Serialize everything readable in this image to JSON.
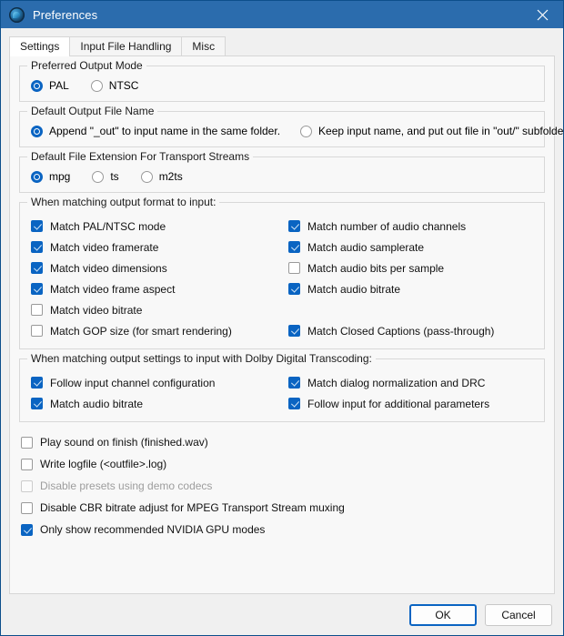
{
  "window": {
    "title": "Preferences",
    "app_icon": "app-globe-icon",
    "close_icon": "close-icon",
    "titlebar_color": "#2b6cad",
    "accent_color": "#0a64c2"
  },
  "tabs": [
    {
      "label": "Settings",
      "selected": true
    },
    {
      "label": "Input File Handling",
      "selected": false
    },
    {
      "label": "Misc",
      "selected": false
    }
  ],
  "groups": {
    "output_mode": {
      "legend": "Preferred Output Mode",
      "options": [
        {
          "label": "PAL",
          "checked": true
        },
        {
          "label": "NTSC",
          "checked": false
        }
      ]
    },
    "output_file_name": {
      "legend": "Default Output File Name",
      "options": [
        {
          "label": "Append \"_out\" to input  name in the same folder.",
          "checked": true
        },
        {
          "label": "Keep input name, and put out file in \"out/\" subfolder.",
          "checked": false
        }
      ]
    },
    "file_extension": {
      "legend": "Default File Extension For Transport Streams",
      "options": [
        {
          "label": "mpg",
          "checked": true
        },
        {
          "label": "ts",
          "checked": false
        },
        {
          "label": "m2ts",
          "checked": false
        }
      ]
    },
    "match_format": {
      "legend": "When matching output format to input:",
      "left_column": [
        {
          "label": "Match PAL/NTSC mode",
          "checked": true
        },
        {
          "label": "Match video framerate",
          "checked": true
        },
        {
          "label": "Match video dimensions",
          "checked": true
        },
        {
          "label": "Match video frame aspect",
          "checked": true
        },
        {
          "label": "Match video bitrate",
          "checked": false
        },
        {
          "label": "Match GOP size (for smart rendering)",
          "checked": false
        }
      ],
      "right_column": [
        {
          "label": "Match number of audio channels",
          "checked": true
        },
        {
          "label": "Match audio samplerate",
          "checked": true
        },
        {
          "label": "Match audio bits per sample",
          "checked": false
        },
        {
          "label": "Match audio bitrate",
          "checked": true
        },
        {
          "label": "",
          "spacer": true
        },
        {
          "label": "Match Closed Captions (pass-through)",
          "checked": true
        }
      ]
    },
    "dolby": {
      "legend": "When matching output settings to input with Dolby Digital Transcoding:",
      "left_column": [
        {
          "label": "Follow input channel configuration",
          "checked": true
        },
        {
          "label": "Match audio bitrate",
          "checked": true
        }
      ],
      "right_column": [
        {
          "label": "Match dialog normalization and DRC",
          "checked": true
        },
        {
          "label": "Follow input for additional parameters",
          "checked": true
        }
      ]
    }
  },
  "misc_options": [
    {
      "label": "Play sound on finish (finished.wav)",
      "checked": false,
      "disabled": false
    },
    {
      "label": "Write logfile (<outfile>.log)",
      "checked": false,
      "disabled": false
    },
    {
      "label": "Disable presets using demo codecs",
      "checked": false,
      "disabled": true
    },
    {
      "label": "Disable CBR bitrate adjust for MPEG Transport Stream muxing",
      "checked": false,
      "disabled": false
    },
    {
      "label": "Only show recommended NVIDIA GPU modes",
      "checked": true,
      "disabled": false
    }
  ],
  "footer": {
    "ok_label": "OK",
    "cancel_label": "Cancel"
  }
}
